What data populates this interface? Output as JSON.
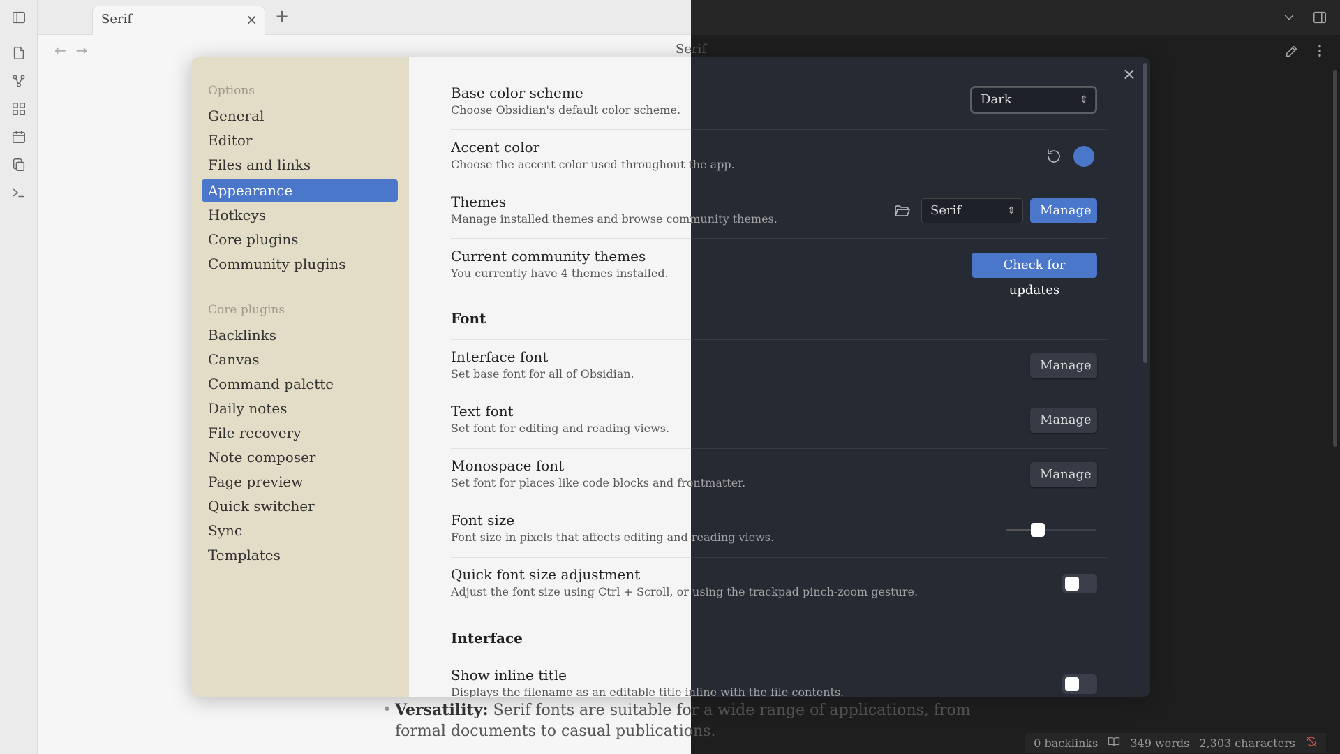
{
  "tab": {
    "title": "Serif",
    "close": "×",
    "new": "+"
  },
  "nav": {
    "back": "←",
    "forward": "→"
  },
  "view": {
    "title": "Serif"
  },
  "note": {
    "bullet_bold": "Versatility:",
    "bullet_text": " Serif fonts are suitable for a wide range of applications, from formal documents to casual publications."
  },
  "status": {
    "backlinks": "0 backlinks",
    "words": "349 words",
    "chars": "2,303 characters"
  },
  "modal": {
    "close": "×",
    "nav": {
      "heading_options": "Options",
      "options": [
        "General",
        "Editor",
        "Files and links",
        "Appearance",
        "Hotkeys",
        "Core plugins",
        "Community plugins"
      ],
      "heading_core": "Core plugins",
      "core": [
        "Backlinks",
        "Canvas",
        "Command palette",
        "Daily notes",
        "File recovery",
        "Note composer",
        "Page preview",
        "Quick switcher",
        "Sync",
        "Templates"
      ]
    },
    "settings": {
      "base_color": {
        "name": "Base color scheme",
        "desc": "Choose Obsidian's default color scheme.",
        "value": "Dark"
      },
      "accent": {
        "name": "Accent color",
        "desc": "Choose the accent color used throughout the app.",
        "color": "#4a77c9"
      },
      "themes": {
        "name": "Themes",
        "desc": "Manage installed themes and browse community themes.",
        "value": "Serif",
        "button": "Manage"
      },
      "community_themes": {
        "name": "Current community themes",
        "desc": "You currently have 4 themes installed.",
        "button": "Check for updates"
      },
      "font_heading": "Font",
      "interface_font": {
        "name": "Interface font",
        "desc": "Set base font for all of Obsidian.",
        "button": "Manage"
      },
      "text_font": {
        "name": "Text font",
        "desc": "Set font for editing and reading views.",
        "button": "Manage"
      },
      "mono_font": {
        "name": "Monospace font",
        "desc": "Set font for places like code blocks and frontmatter.",
        "button": "Manage"
      },
      "font_size": {
        "name": "Font size",
        "desc": "Font size in pixels that affects editing and reading views.",
        "fraction": 0.35
      },
      "quick_font": {
        "name": "Quick font size adjustment",
        "desc": "Adjust the font size using Ctrl + Scroll, or using the trackpad pinch-zoom gesture."
      },
      "interface_heading": "Interface",
      "inline_title": {
        "name": "Show inline title",
        "desc": "Displays the filename as an editable title inline with the file contents."
      }
    }
  }
}
